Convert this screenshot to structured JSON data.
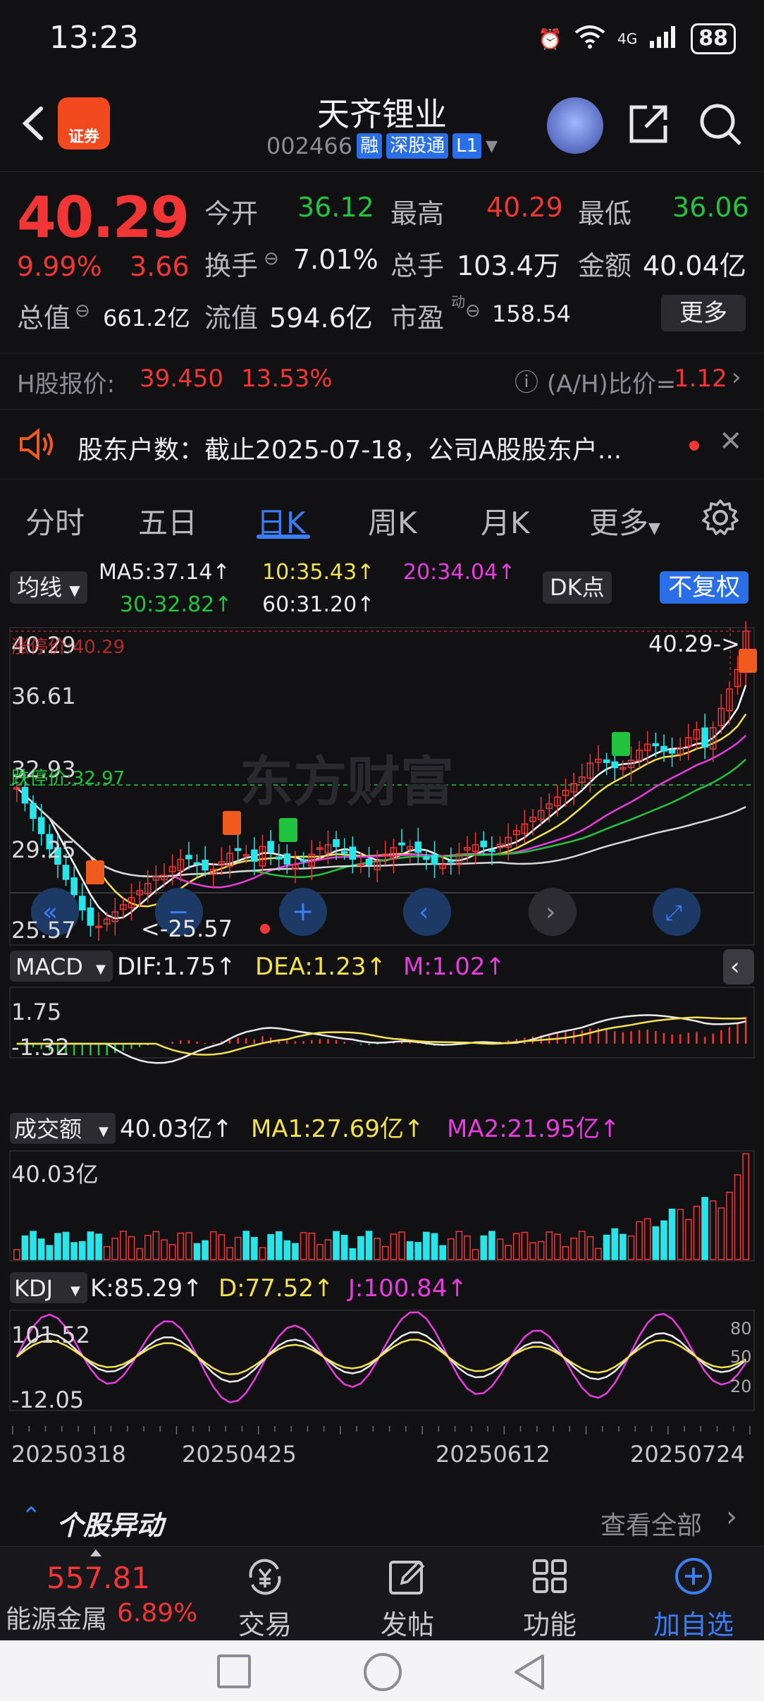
{
  "status_bar": {
    "time": "13:23",
    "battery": "88",
    "network": "4G"
  },
  "header": {
    "logo_text": "证券",
    "stock_name": "天齐锂业",
    "stock_code": "002466",
    "tags": [
      "融",
      "深股通",
      "L1"
    ]
  },
  "quote": {
    "price": "40.29",
    "pct_change": "9.99%",
    "abs_change": "3.66",
    "open_label": "今开",
    "open": "36.12",
    "high_label": "最高",
    "high": "40.29",
    "low_label": "最低",
    "low": "36.06",
    "turnover_label": "换手",
    "turnover": "7.01%",
    "volume_label": "总手",
    "volume": "103.4万",
    "amount_label": "金额",
    "amount": "40.04亿",
    "mktcap_label": "总值",
    "mktcap": "661.2亿",
    "float_label": "流值",
    "float": "594.6亿",
    "pe_label": "市盈",
    "pe_sup": "动",
    "pe": "158.54",
    "more_label": "更多"
  },
  "hk": {
    "label": "H股报价:",
    "price": "39.450",
    "pct": "13.53%",
    "ratio_label": "(A/H)比价=",
    "ratio": "1.12"
  },
  "notice": {
    "text": "股东户数：截止2025-07-18，公司A股股东户..."
  },
  "tabs": [
    "分时",
    "五日",
    "日K",
    "周K",
    "月K",
    "更多"
  ],
  "indicators": {
    "ma_selector": "均线",
    "ma5": "MA5:37.14↑",
    "ma10": "10:35.43↑",
    "ma20": "20:34.04↑",
    "ma30": "30:32.82↑",
    "ma60": "60:31.20↑",
    "dk_label": "DK点",
    "adjust_label": "不复权"
  },
  "kline": {
    "y_max": "40.29",
    "y_2": "36.61",
    "y_3": "32.93",
    "y_4": "29.25",
    "y_min": "25.57",
    "limit_up_label": "涨停价:40.29",
    "limit_down_label": "跌停价:32.97",
    "last_marker": "40.29->",
    "low_marker": "<-25.57",
    "watermark": "东方财富",
    "colors": {
      "up": "#f23535",
      "down": "#29e5ea",
      "ma5": "#ffffff",
      "ma10": "#f4e24c",
      "ma20": "#e93ce0",
      "ma30": "#22c43f",
      "ma60": "#d8d8d8"
    }
  },
  "macd": {
    "selector": "MACD",
    "dif": "DIF:1.75↑",
    "dea": "DEA:1.23↑",
    "m": "M:1.02↑",
    "y_max": "1.75",
    "y_min": "-1.32"
  },
  "volume": {
    "selector": "成交额",
    "value": "40.03亿↑",
    "ma1": "MA1:27.69亿↑",
    "ma2": "MA2:21.95亿↑",
    "y_max": "40.03亿"
  },
  "kdj": {
    "selector": "KDJ",
    "k": "K:85.29↑",
    "d": "D:77.52↑",
    "j": "J:100.84↑",
    "y_max": "101.52",
    "y_min": "-12.05",
    "levels": [
      "80",
      "50",
      "20"
    ]
  },
  "dates": [
    "20250318",
    "20250425",
    "20250612",
    "20250724"
  ],
  "events": {
    "title": "个股异动",
    "view_all": "查看全部"
  },
  "bottom_nav": {
    "index_value": "557.81",
    "index_name": "能源金属",
    "index_pct": "6.89%",
    "items": [
      "交易",
      "发帖",
      "功能",
      "加自选"
    ]
  }
}
